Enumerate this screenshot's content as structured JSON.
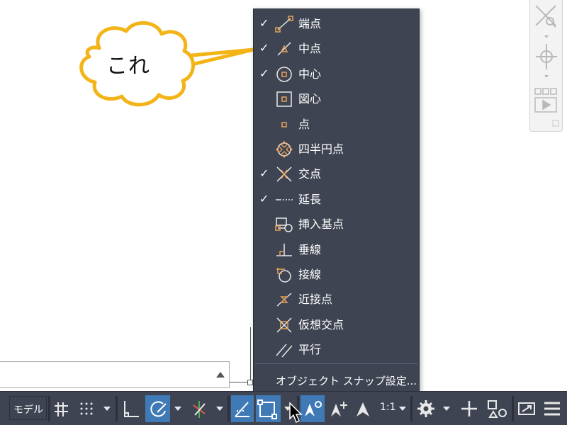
{
  "callout": {
    "text": "これ"
  },
  "command_line": {
    "value": ""
  },
  "osnap_menu": {
    "items": [
      {
        "label": "端点",
        "checked": true,
        "icon": "endpoint-icon"
      },
      {
        "label": "中点",
        "checked": true,
        "icon": "midpoint-icon"
      },
      {
        "label": "中心",
        "checked": true,
        "icon": "center-icon"
      },
      {
        "label": "図心",
        "checked": false,
        "icon": "centroid-icon"
      },
      {
        "label": "点",
        "checked": false,
        "icon": "node-icon"
      },
      {
        "label": "四半円点",
        "checked": false,
        "icon": "quadrant-icon"
      },
      {
        "label": "交点",
        "checked": true,
        "icon": "intersection-icon"
      },
      {
        "label": "延長",
        "checked": true,
        "icon": "extension-icon"
      },
      {
        "label": "挿入基点",
        "checked": false,
        "icon": "insertion-icon"
      },
      {
        "label": "垂線",
        "checked": false,
        "icon": "perpendicular-icon"
      },
      {
        "label": "接線",
        "checked": false,
        "icon": "tangent-icon"
      },
      {
        "label": "近接点",
        "checked": false,
        "icon": "nearest-icon"
      },
      {
        "label": "仮想交点",
        "checked": false,
        "icon": "apparent-intersection-icon"
      },
      {
        "label": "平行",
        "checked": false,
        "icon": "parallel-icon"
      }
    ],
    "settings_label": "オブジェクト スナップ設定..."
  },
  "statusbar": {
    "model_label": "モデル",
    "scale_label": "1:1"
  },
  "colors": {
    "menu_bg": "#3e4452",
    "accent": "#3f7ab6",
    "snap_orange": "#e8a25a",
    "callout_border": "#f2b417"
  }
}
